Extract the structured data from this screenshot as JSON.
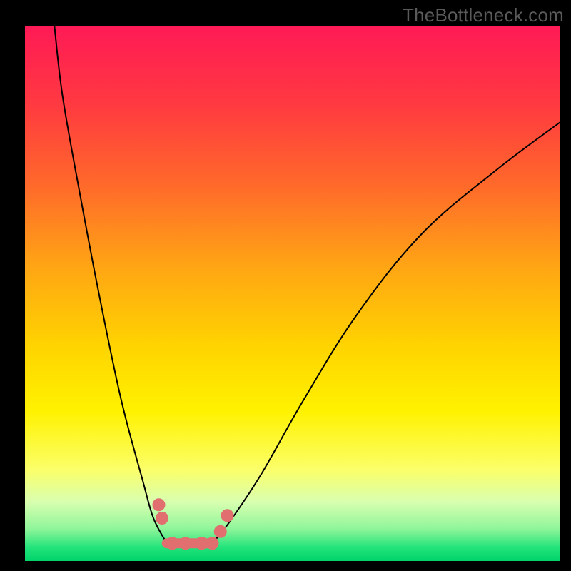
{
  "watermark": "TheBottleneck.com",
  "colors": {
    "page_bg": "#000000",
    "watermark_text": "#5a5a5a",
    "curve_stroke": "#000000",
    "marker_fill": "#e16f6f",
    "gradient_top": "#ff1a56",
    "gradient_bottom": "#00d36b"
  },
  "chart_data": {
    "type": "line",
    "title": "",
    "xlabel": "",
    "ylabel": "",
    "xlim": [
      0,
      100
    ],
    "ylim": [
      0,
      100
    ],
    "grid": false,
    "notes": "Bottleneck-style V-curve. Two sweeping black curves drop from top edges toward a flat minimum near x≈27–35. Left branch from upper-left corner; right branch exits near upper-right. Salmon markers cluster around the trough/floor segment. Height encodes bottleneck severity (top = worst/red, bottom = best/green). Axes are unlabeled.",
    "series": [
      {
        "name": "left_branch",
        "x": [
          5.5,
          7,
          10,
          14,
          18,
          22,
          24,
          26.5
        ],
        "y": [
          100,
          87,
          70,
          49,
          30,
          15,
          8,
          3.3
        ]
      },
      {
        "name": "right_branch",
        "x": [
          35,
          38,
          44,
          52,
          62,
          74,
          88,
          100
        ],
        "y": [
          3.3,
          7,
          16,
          30,
          46,
          61,
          73,
          82
        ]
      },
      {
        "name": "floor_segment",
        "x": [
          26.5,
          35
        ],
        "y": [
          3.3,
          3.3
        ]
      }
    ],
    "markers": [
      {
        "x": 25.0,
        "y": 10.5
      },
      {
        "x": 25.6,
        "y": 8.0
      },
      {
        "x": 27.5,
        "y": 3.3
      },
      {
        "x": 30.0,
        "y": 3.3
      },
      {
        "x": 33.0,
        "y": 3.3
      },
      {
        "x": 35.0,
        "y": 3.3
      },
      {
        "x": 36.5,
        "y": 5.5
      },
      {
        "x": 37.8,
        "y": 8.5
      }
    ]
  }
}
